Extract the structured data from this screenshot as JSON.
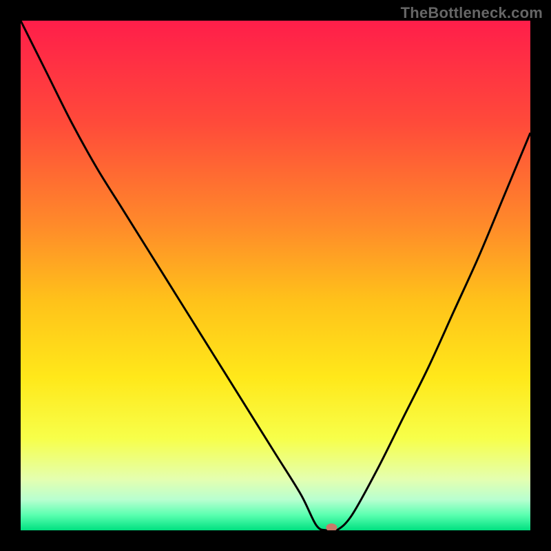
{
  "watermark": "TheBottleneck.com",
  "chart_data": {
    "type": "line",
    "title": "",
    "xlabel": "",
    "ylabel": "",
    "xlim": [
      0,
      100
    ],
    "ylim": [
      0,
      100
    ],
    "x": [
      0,
      5,
      10,
      15,
      20,
      25,
      30,
      35,
      40,
      45,
      50,
      55,
      58,
      60,
      62,
      65,
      70,
      75,
      80,
      85,
      90,
      95,
      100
    ],
    "values": [
      100,
      90,
      80,
      71,
      63,
      55,
      47,
      39,
      31,
      23,
      15,
      7,
      1,
      0,
      0,
      3,
      12,
      22,
      32,
      43,
      54,
      66,
      78
    ],
    "marker": {
      "x": 61,
      "y": 0
    },
    "gradient_stops": [
      {
        "offset": 0.0,
        "color": "#ff1e4a"
      },
      {
        "offset": 0.2,
        "color": "#ff4a3a"
      },
      {
        "offset": 0.4,
        "color": "#ff8a2a"
      },
      {
        "offset": 0.55,
        "color": "#ffc21a"
      },
      {
        "offset": 0.7,
        "color": "#ffe81a"
      },
      {
        "offset": 0.82,
        "color": "#f7ff4a"
      },
      {
        "offset": 0.9,
        "color": "#e4ffb0"
      },
      {
        "offset": 0.94,
        "color": "#b8ffd0"
      },
      {
        "offset": 0.97,
        "color": "#5affb0"
      },
      {
        "offset": 1.0,
        "color": "#00e080"
      }
    ]
  }
}
